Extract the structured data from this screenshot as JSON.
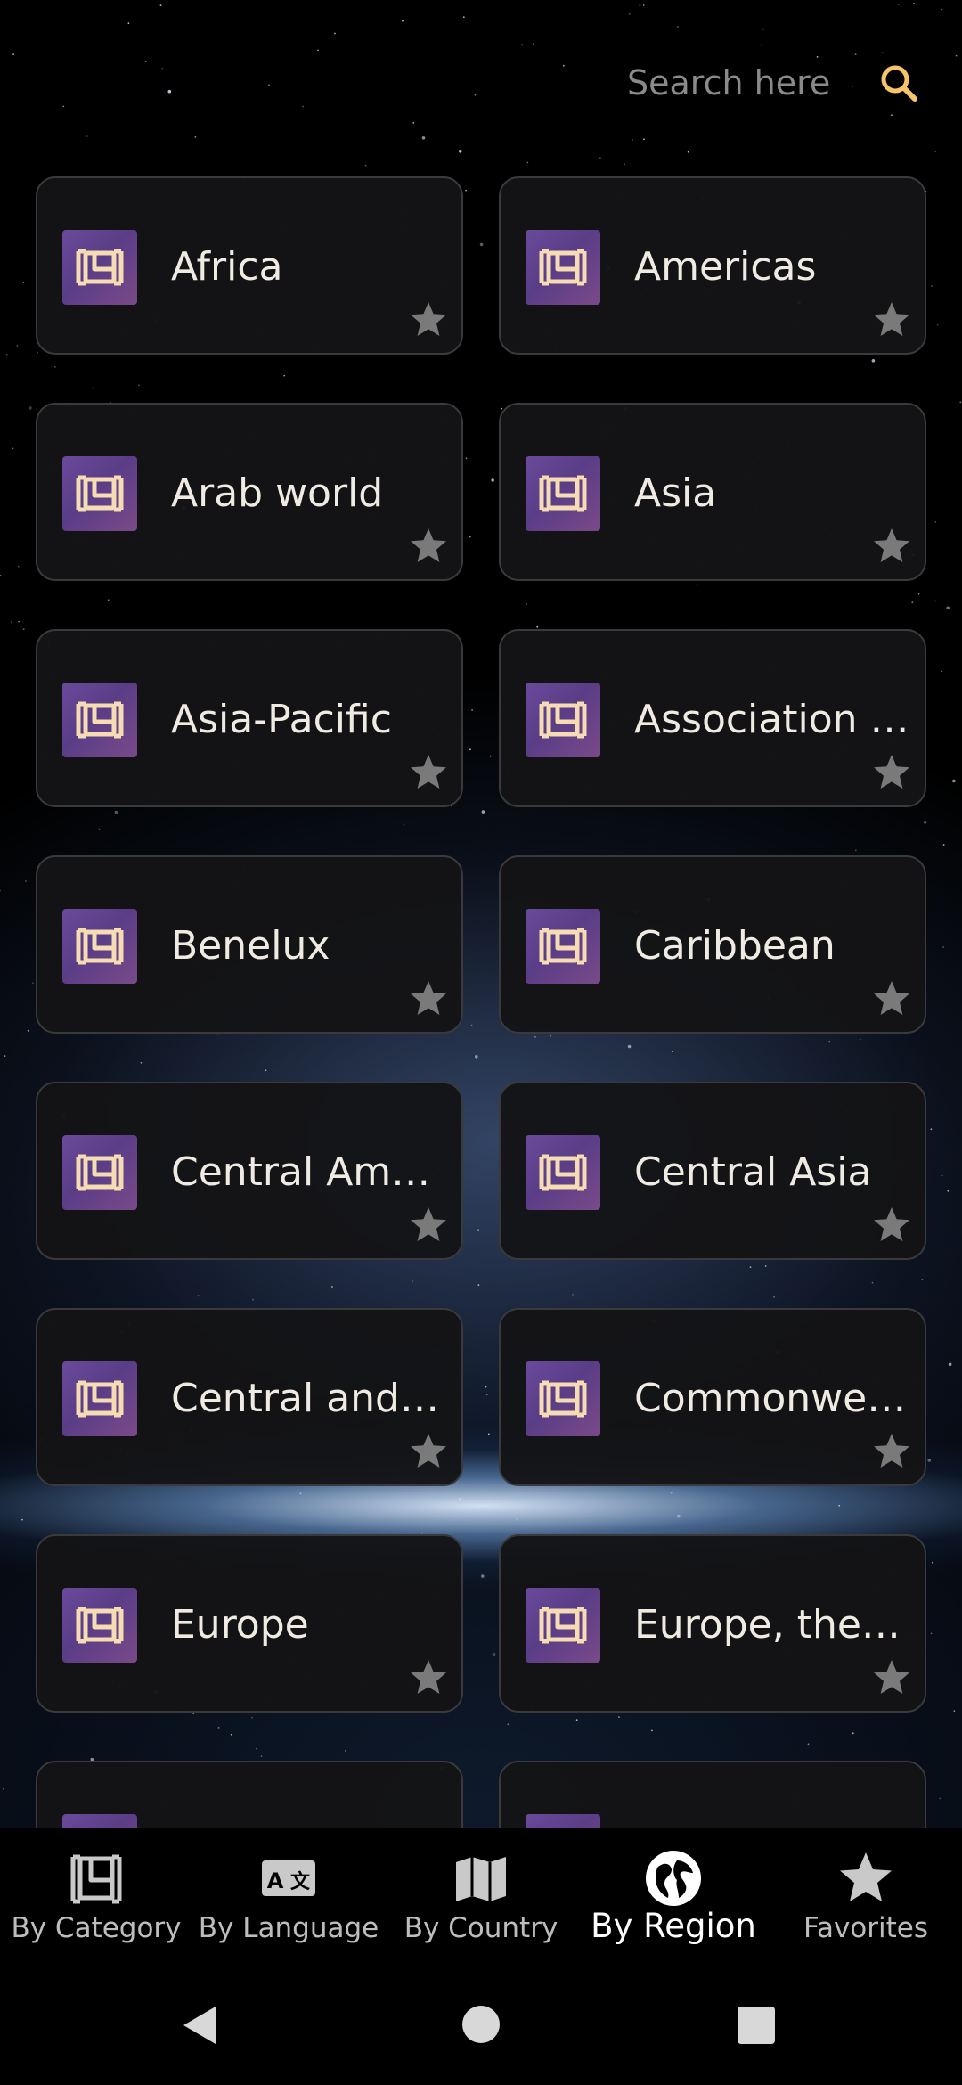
{
  "search": {
    "placeholder": "Search here",
    "value": ""
  },
  "regions": [
    {
      "label": "Africa",
      "icon": "image-frame-icon",
      "favorited": false
    },
    {
      "label": "Americas",
      "icon": "image-frame-icon",
      "favorited": false
    },
    {
      "label": "Arab world",
      "icon": "image-frame-icon",
      "favorited": false
    },
    {
      "label": "Asia",
      "icon": "image-frame-icon",
      "favorited": false
    },
    {
      "label": "Asia-Pacific",
      "icon": "image-frame-icon",
      "favorited": false
    },
    {
      "label": "Association o...",
      "icon": "image-frame-icon",
      "favorited": false
    },
    {
      "label": "Benelux",
      "icon": "image-frame-icon",
      "favorited": false
    },
    {
      "label": "Caribbean",
      "icon": "image-frame-icon",
      "favorited": false
    },
    {
      "label": "Central Amer...",
      "icon": "image-frame-icon",
      "favorited": false
    },
    {
      "label": "Central Asia",
      "icon": "image-frame-icon",
      "favorited": false
    },
    {
      "label": "Central and E...",
      "icon": "image-frame-icon",
      "favorited": false
    },
    {
      "label": "Commonwea...",
      "icon": "image-frame-icon",
      "favorited": false
    },
    {
      "label": "Europe",
      "icon": "image-frame-icon",
      "favorited": false
    },
    {
      "label": "Europe, the ...",
      "icon": "image-frame-icon",
      "favorited": false
    },
    {
      "label": "",
      "icon": "image-frame-icon",
      "favorited": false
    },
    {
      "label": "",
      "icon": "image-frame-icon",
      "favorited": false
    }
  ],
  "bottom_nav": [
    {
      "label": "By Category",
      "icon": "category-icon",
      "active": false
    },
    {
      "label": "By Language",
      "icon": "translate-icon",
      "active": false
    },
    {
      "label": "By Country",
      "icon": "map-icon",
      "active": false
    },
    {
      "label": "By Region",
      "icon": "globe-icon",
      "active": true
    },
    {
      "label": "Favorites",
      "icon": "star-icon",
      "active": false
    }
  ],
  "colors": {
    "accent": "#f5c46b",
    "card_bg": "#141416",
    "icon_bg": "#5e4190",
    "star_inactive": "#7a7a7a",
    "nav_active": "#ffffff",
    "nav_inactive": "#bdbdbd"
  }
}
